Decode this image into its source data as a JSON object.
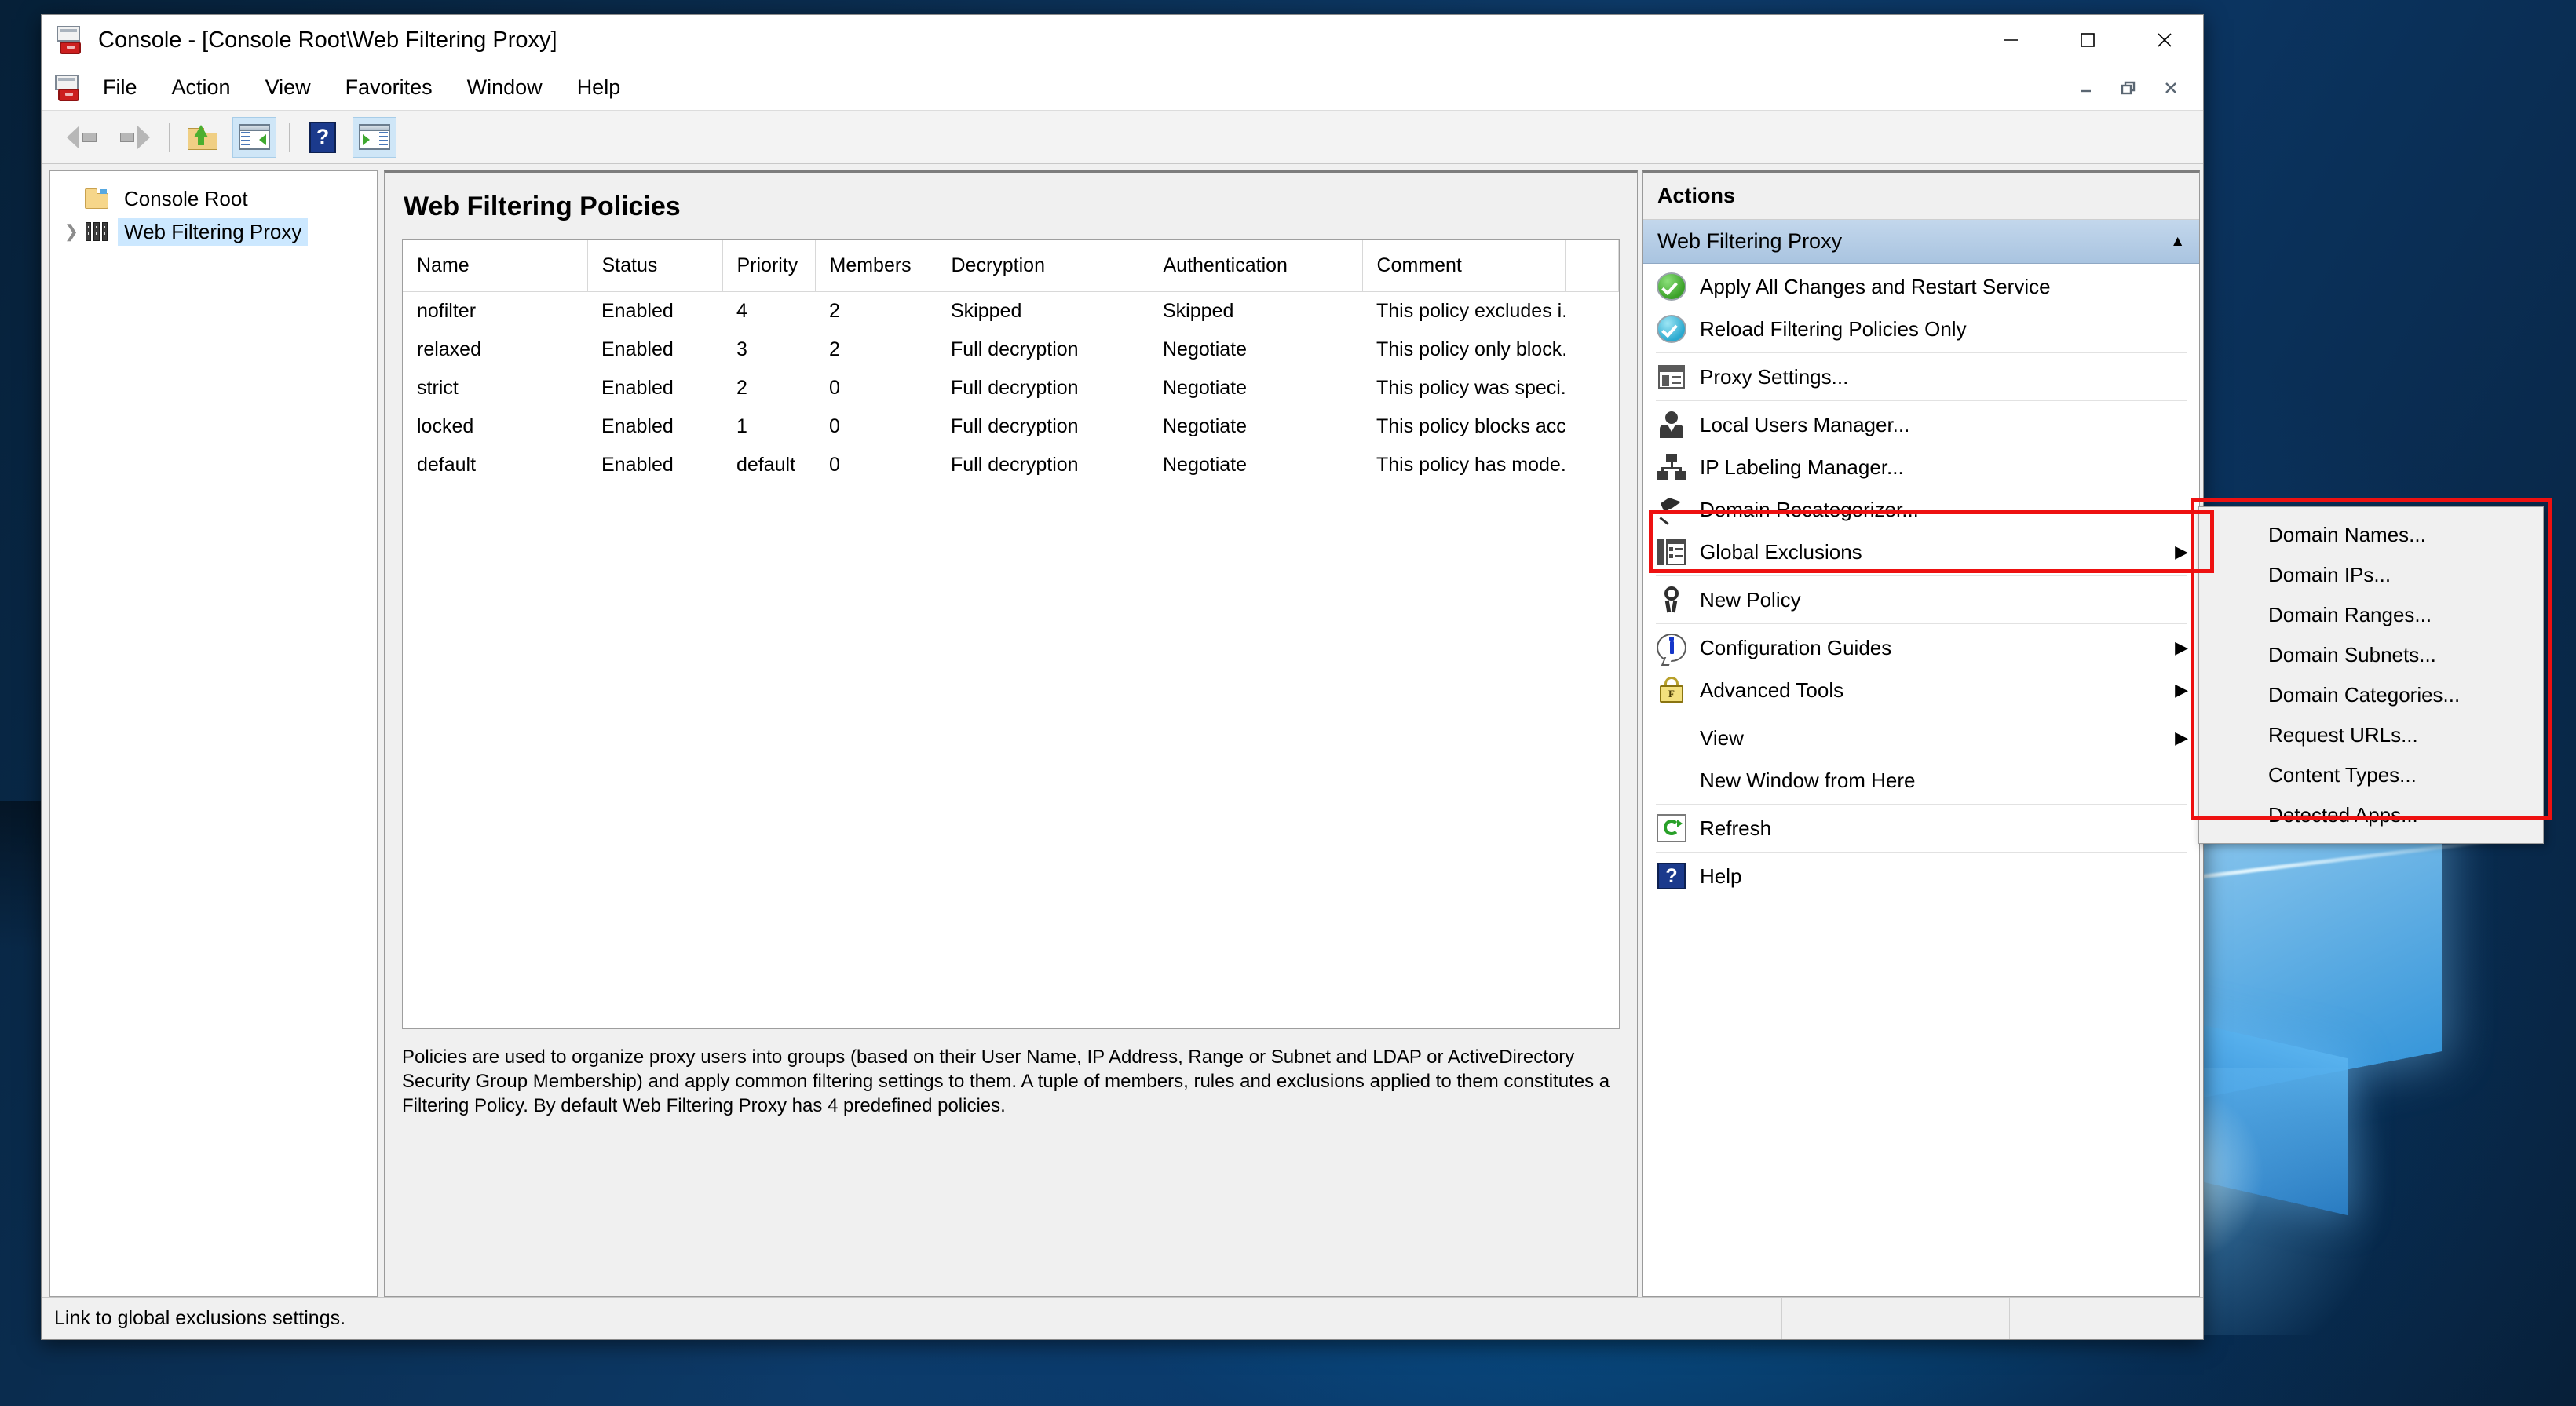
{
  "window": {
    "title": "Console - [Console Root\\Web Filtering Proxy]",
    "app_icon": "mmc-console-icon",
    "controls": {
      "minimize": "minimize-icon",
      "maximize": "maximize-icon",
      "close": "close-icon"
    },
    "mdi_controls": {
      "minimize": "mdi-minimize-icon",
      "restore": "mdi-restore-icon",
      "close": "mdi-close-icon"
    }
  },
  "menu_bar": {
    "icon": "mmc-console-icon",
    "items": [
      {
        "label": "File"
      },
      {
        "label": "Action"
      },
      {
        "label": "View"
      },
      {
        "label": "Favorites"
      },
      {
        "label": "Window"
      },
      {
        "label": "Help"
      }
    ]
  },
  "toolbar": {
    "buttons": [
      {
        "name": "back-button",
        "icon": "back-arrow-icon",
        "active": false
      },
      {
        "name": "forward-button",
        "icon": "forward-arrow-icon",
        "active": false
      },
      {
        "name": "up-one-level-button",
        "icon": "show-folder-icon",
        "active": false
      },
      {
        "name": "show-hide-tree-button",
        "icon": "left-pane-icon",
        "active": true
      },
      {
        "name": "help-button",
        "icon": "help-icon",
        "active": false
      },
      {
        "name": "show-hide-actions-button",
        "icon": "right-pane-icon",
        "active": true
      }
    ]
  },
  "tree": {
    "items": [
      {
        "label": "Console Root",
        "icon": "folder-icon",
        "expandable": false,
        "selected": false,
        "indent": 0
      },
      {
        "label": "Web Filtering Proxy",
        "icon": "server-rack-icon",
        "expandable": true,
        "selected": true,
        "indent": 1
      }
    ]
  },
  "result_pane": {
    "title": "Web Filtering Policies",
    "columns": [
      "Name",
      "Status",
      "Priority",
      "Members",
      "Decryption",
      "Authentication",
      "Comment"
    ],
    "rows": [
      {
        "name": "nofilter",
        "status": "Enabled",
        "priority": "4",
        "members": "2",
        "decryption": "Skipped",
        "authentication": "Skipped",
        "comment": "This policy excludes i..."
      },
      {
        "name": "relaxed",
        "status": "Enabled",
        "priority": "3",
        "members": "2",
        "decryption": "Full decryption",
        "authentication": "Negotiate",
        "comment": "This policy only block..."
      },
      {
        "name": "strict",
        "status": "Enabled",
        "priority": "2",
        "members": "0",
        "decryption": "Full decryption",
        "authentication": "Negotiate",
        "comment": "This policy was speci..."
      },
      {
        "name": "locked",
        "status": "Enabled",
        "priority": "1",
        "members": "0",
        "decryption": "Full decryption",
        "authentication": "Negotiate",
        "comment": "This policy blocks acc..."
      },
      {
        "name": "default",
        "status": "Enabled",
        "priority": "default",
        "members": "0",
        "decryption": "Full decryption",
        "authentication": "Negotiate",
        "comment": "This policy has mode..."
      }
    ],
    "description": "Policies are used to organize proxy users into groups (based on their User Name, IP Address, Range or Subnet and LDAP or ActiveDirectory Security Group Membership) and apply common filtering settings to them. A tuple of members, rules and exclusions applied to them constitutes a Filtering Policy. By default Web Filtering Proxy has 4 predefined policies."
  },
  "actions_pane": {
    "caption": "Actions",
    "group_header": {
      "label": "Web Filtering Proxy",
      "chevron": "chevron-up-icon"
    },
    "items": [
      {
        "label": "Apply All Changes and Restart Service",
        "icon": "green-check-icon",
        "submenu": false,
        "sep_after": false,
        "highlighted": false
      },
      {
        "label": "Reload Filtering Policies Only",
        "icon": "cyan-check-icon",
        "submenu": false,
        "sep_after": true,
        "highlighted": false
      },
      {
        "label": "Proxy Settings...",
        "icon": "properties-icon",
        "submenu": false,
        "sep_after": true,
        "highlighted": false
      },
      {
        "label": "Local Users Manager...",
        "icon": "user-icon",
        "submenu": false,
        "sep_after": false,
        "highlighted": false
      },
      {
        "label": "IP Labeling Manager...",
        "icon": "network-icon",
        "submenu": false,
        "sep_after": false,
        "highlighted": false
      },
      {
        "label": "Domain Recategorizer...",
        "icon": "pin-icon",
        "submenu": false,
        "sep_after": false,
        "highlighted": false
      },
      {
        "label": "Global Exclusions",
        "icon": "exclusions-icon",
        "submenu": true,
        "sep_after": true,
        "highlighted": true
      },
      {
        "label": "New Policy",
        "icon": "policy-icon",
        "submenu": false,
        "sep_after": true,
        "highlighted": false
      },
      {
        "label": "Configuration Guides",
        "icon": "info-icon",
        "submenu": true,
        "sep_after": false,
        "highlighted": false
      },
      {
        "label": "Advanced Tools",
        "icon": "lock-icon",
        "submenu": true,
        "sep_after": true,
        "highlighted": false
      },
      {
        "label": "View",
        "icon": "",
        "submenu": true,
        "sep_after": false,
        "highlighted": false
      },
      {
        "label": "New Window from Here",
        "icon": "",
        "submenu": false,
        "sep_after": true,
        "highlighted": false
      },
      {
        "label": "Refresh",
        "icon": "refresh-icon",
        "submenu": false,
        "sep_after": true,
        "highlighted": false
      },
      {
        "label": "Help",
        "icon": "help-icon",
        "submenu": false,
        "sep_after": false,
        "highlighted": false
      }
    ]
  },
  "submenu": {
    "parent": "Global Exclusions",
    "items": [
      {
        "label": "Domain Names..."
      },
      {
        "label": "Domain IPs..."
      },
      {
        "label": "Domain Ranges..."
      },
      {
        "label": "Domain Subnets..."
      },
      {
        "label": "Domain Categories..."
      },
      {
        "label": "Request URLs..."
      },
      {
        "label": "Content Types..."
      },
      {
        "label": "Detected Apps..."
      }
    ]
  },
  "status_bar": {
    "text": "Link to global exclusions settings."
  },
  "colors": {
    "annotation_red": "#ee1111",
    "selection_blue": "#cce8ff",
    "actions_header_blue": "#a9c4e0",
    "desktop_blue": "#0d3a68"
  }
}
